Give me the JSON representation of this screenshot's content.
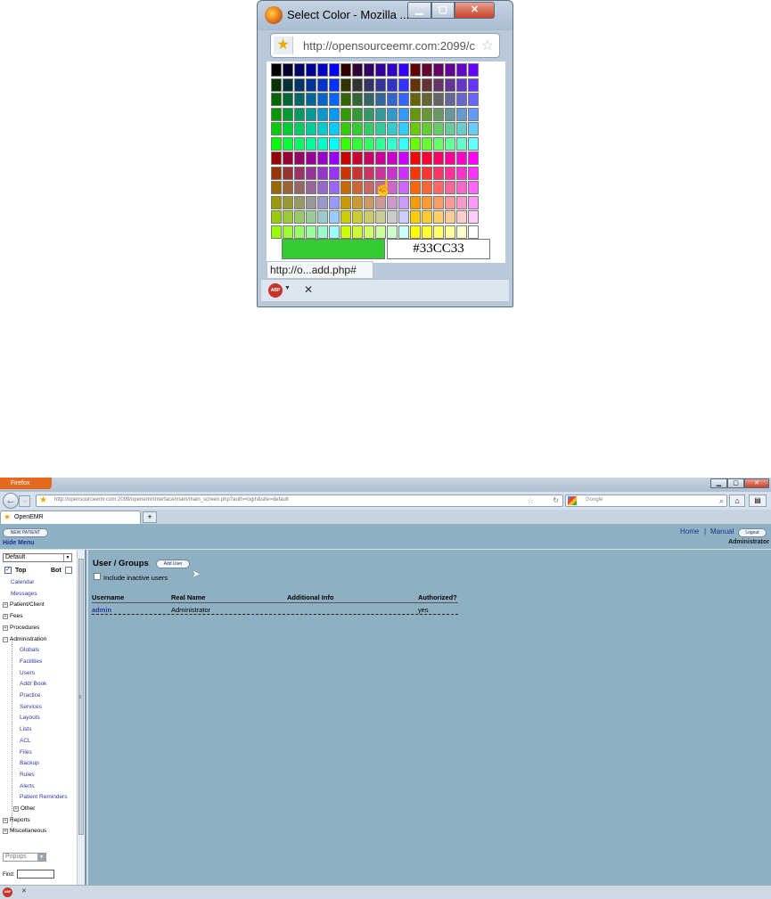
{
  "popup": {
    "title": "Select Color - Mozilla ...",
    "url": "http://opensourceemr.com:2099/c",
    "status_url": "http://o...add.php#",
    "selected_hex": "#33CC33",
    "selected_color": "#33CC33",
    "icons": [
      "firefox-icon",
      "minimize-icon",
      "maximize-icon",
      "close-icon",
      "star-icon",
      "bookmark-star-icon",
      "hand-cursor-icon",
      "adblock-icon",
      "close-icon"
    ],
    "abp_label": "ABP"
  },
  "browser": {
    "firefox_menu": "Firefox",
    "url_host": "opensourceemr.com",
    "url": "http://opensourceemr.com:2099/openemr/interface/main/main_screen.php?auth=login&site=default",
    "search_placeholder": "Google",
    "tab_label": "OpenEMR",
    "newtab": "+"
  },
  "emr_header": {
    "new_patient": "NEW PATIENT",
    "hide_menu": "Hide Menu",
    "home": "Home",
    "separator": "|",
    "manual": "Manual",
    "logout": "Logout",
    "user": "Administrator"
  },
  "nav": {
    "select_value": "Default",
    "top_label": "Top",
    "bot_label": "Bot",
    "top_checked": true,
    "bot_checked": false,
    "items": [
      {
        "label": "Calendar",
        "type": "link"
      },
      {
        "label": "Messages",
        "type": "link"
      },
      {
        "label": "Patient/Client",
        "type": "plus"
      },
      {
        "label": "Fees",
        "type": "plus"
      },
      {
        "label": "Procedures",
        "type": "plus"
      },
      {
        "label": "Administration",
        "type": "minus"
      },
      {
        "label": "Globals",
        "type": "sub"
      },
      {
        "label": "Facilities",
        "type": "sub"
      },
      {
        "label": "Users",
        "type": "sub"
      },
      {
        "label": "Addr Book",
        "type": "sub"
      },
      {
        "label": "Practice",
        "type": "sub"
      },
      {
        "label": "Services",
        "type": "sub"
      },
      {
        "label": "Layouts",
        "type": "sub"
      },
      {
        "label": "Lists",
        "type": "sub"
      },
      {
        "label": "ACL",
        "type": "sub"
      },
      {
        "label": "Files",
        "type": "sub"
      },
      {
        "label": "Backup",
        "type": "sub"
      },
      {
        "label": "Rules",
        "type": "sub"
      },
      {
        "label": "Alerts",
        "type": "sub"
      },
      {
        "label": "Patient Reminders",
        "type": "sub"
      },
      {
        "label": "Other",
        "type": "subplus"
      },
      {
        "label": "Reports",
        "type": "plus"
      },
      {
        "label": "Miscellaneous",
        "type": "plus"
      }
    ],
    "popups_label": "Popups",
    "find_label": "Find:",
    "find_value": ""
  },
  "content": {
    "heading": "User / Groups",
    "add_user": "Add User",
    "include_inactive": "Include inactive users",
    "include_inactive_checked": false,
    "columns": [
      "Username",
      "Real Name",
      "Additional Info",
      "Authorized?"
    ],
    "rows": [
      {
        "username": "admin",
        "real_name": "Administrator",
        "info": "",
        "authorized": "yes"
      }
    ]
  },
  "addon_bar": {
    "abp_label": "ABP",
    "close": "✕"
  }
}
